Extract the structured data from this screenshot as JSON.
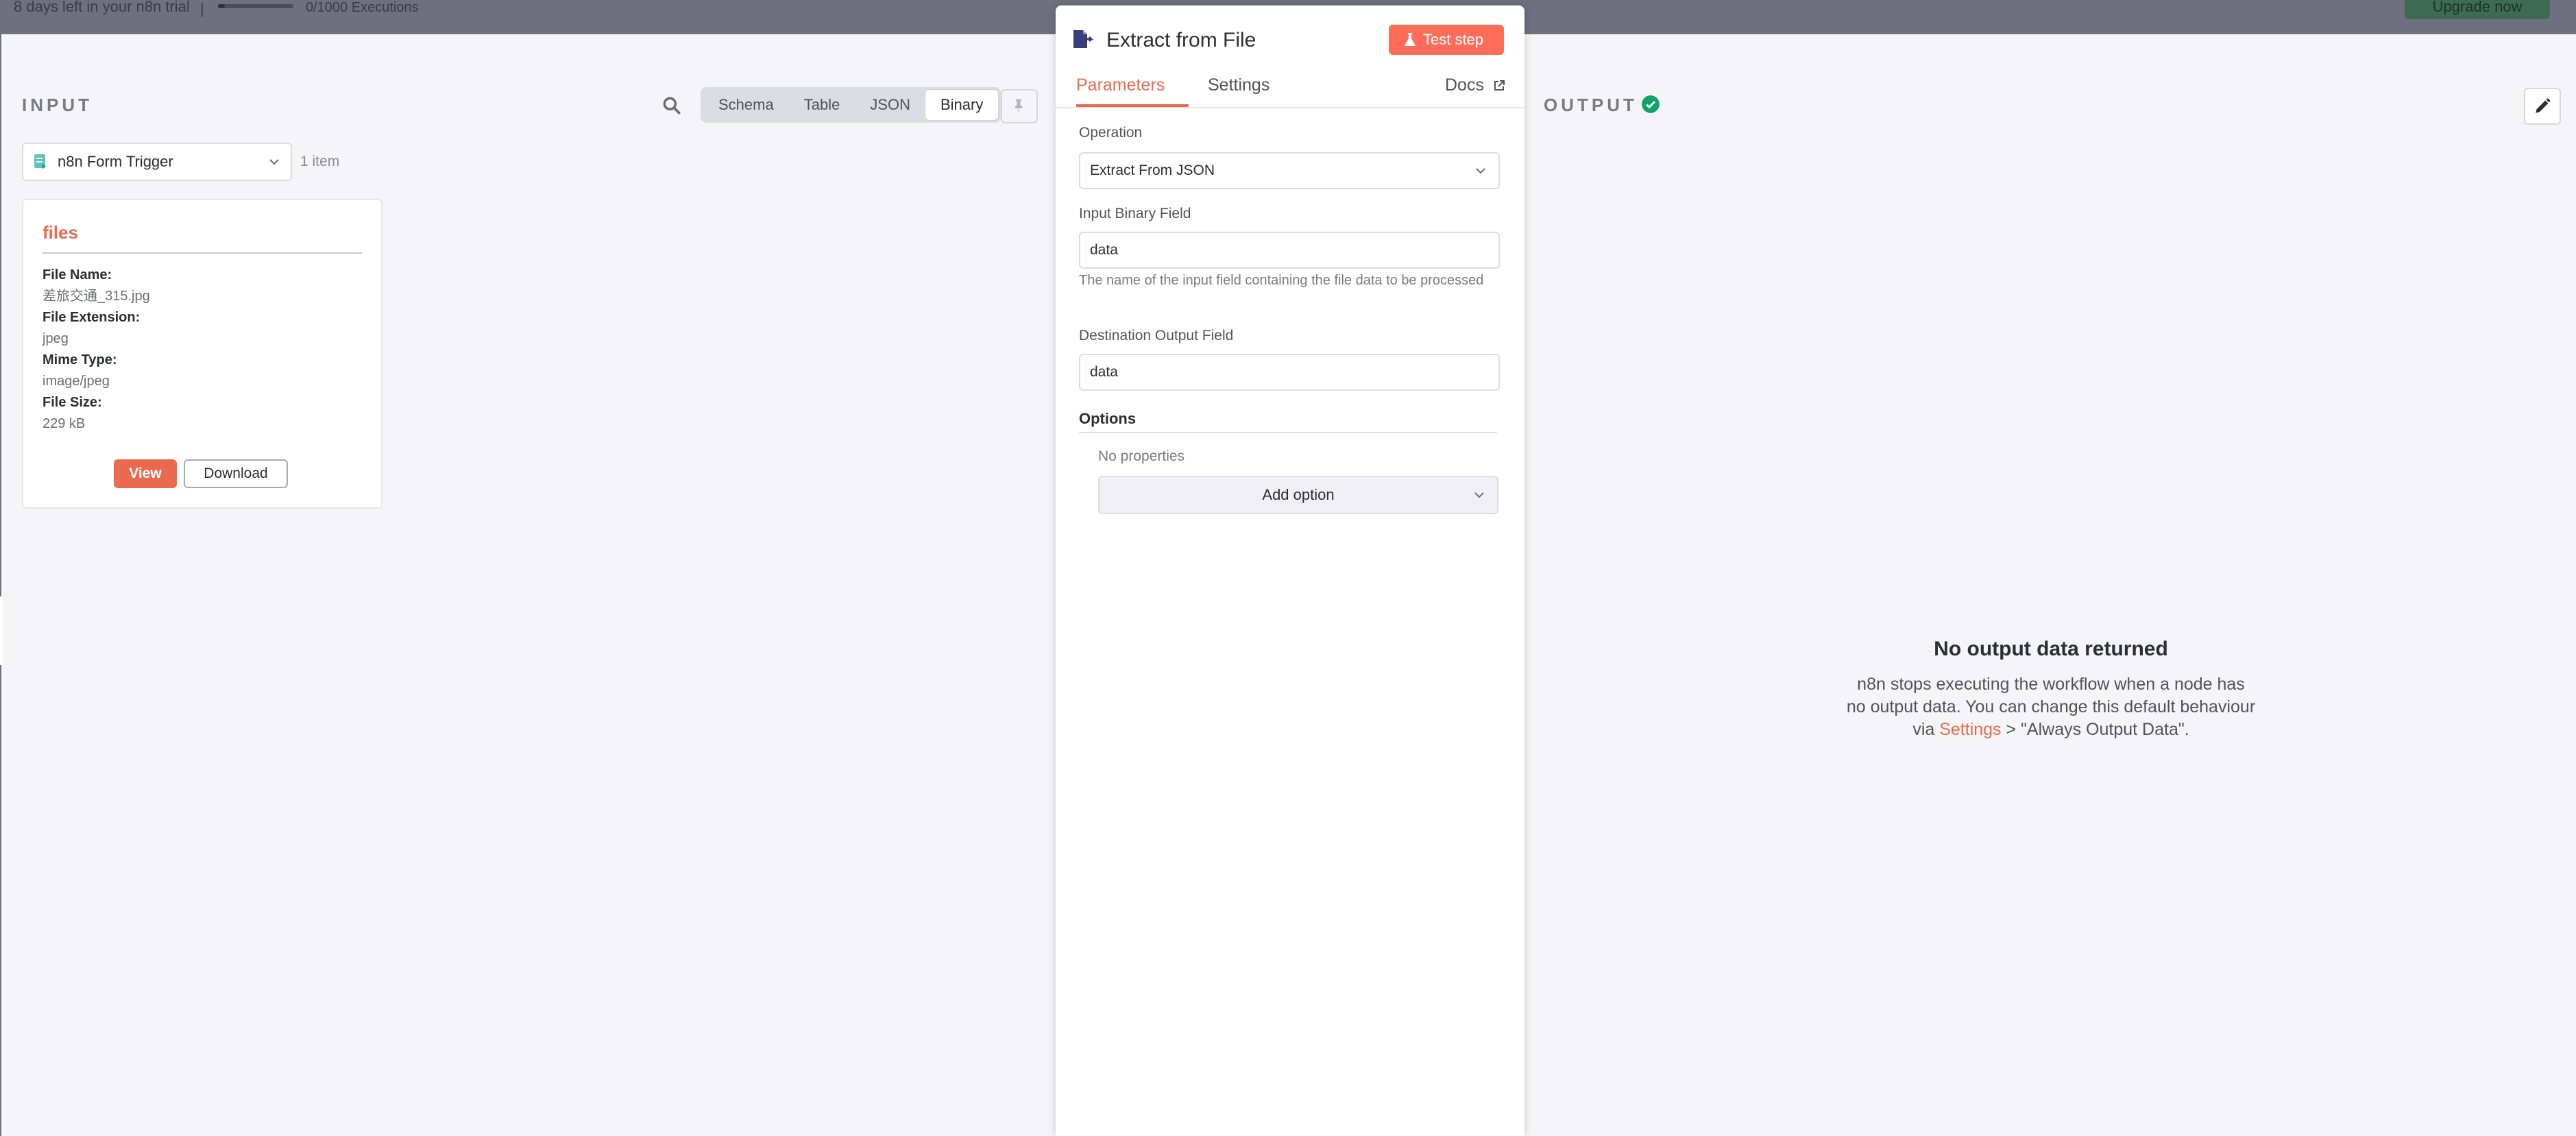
{
  "topbar": {
    "trial_text": "8 days left in your n8n trial",
    "separator": "|",
    "executions_text": "0/1000 Executions",
    "upgrade_label": "Upgrade now"
  },
  "input_panel": {
    "title": "INPUT",
    "display_modes": [
      "Schema",
      "Table",
      "JSON",
      "Binary"
    ],
    "active_mode": "Binary",
    "node_selector": "n8n Form Trigger",
    "item_count": "1 item",
    "binary": {
      "field_name": "files",
      "rows": [
        {
          "label": "File Name:",
          "value": "差旅交通_315.jpg"
        },
        {
          "label": "File Extension:",
          "value": "jpeg"
        },
        {
          "label": "Mime Type:",
          "value": "image/jpeg"
        },
        {
          "label": "File Size:",
          "value": "229 kB"
        }
      ],
      "view_label": "View",
      "download_label": "Download"
    }
  },
  "node_panel": {
    "title": "Extract from File",
    "test_label": "Test step",
    "tabs": [
      "Parameters",
      "Settings"
    ],
    "active_tab": "Parameters",
    "docs_label": "Docs",
    "operation_label": "Operation",
    "operation_value": "Extract From JSON",
    "input_binary_label": "Input Binary Field",
    "input_binary_value": "data",
    "input_binary_hint": "The name of the input field containing the file data to be processed",
    "destination_label": "Destination Output Field",
    "destination_value": "data",
    "options_label": "Options",
    "no_properties": "No properties",
    "add_option_label": "Add option"
  },
  "output_panel": {
    "title": "OUTPUT",
    "empty_title": "No output data returned",
    "empty_text_before": "n8n stops executing the workflow when a node has no output data. You can change this default behaviour via ",
    "empty_link": "Settings",
    "empty_text_after": " > \"Always Output Data\"."
  },
  "colors": {
    "accent": "#ff6d5a",
    "link": "#ea6a4f",
    "success": "#0fa26b",
    "overlay": "#6e6f7f"
  }
}
